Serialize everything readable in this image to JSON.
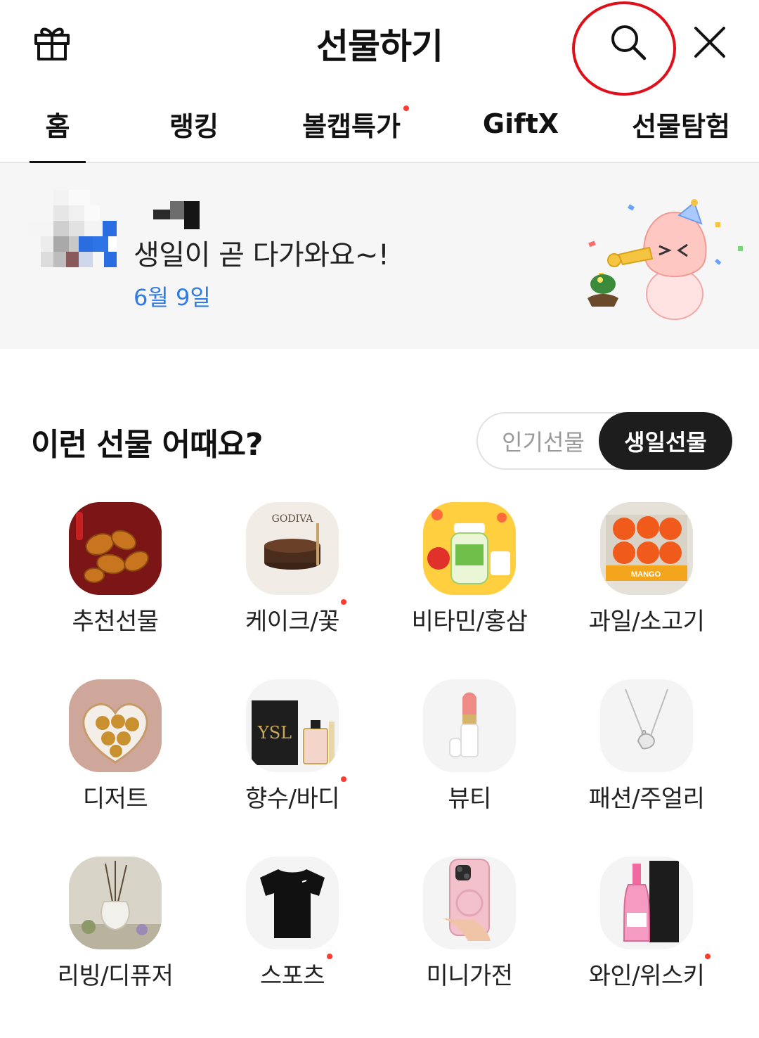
{
  "header": {
    "title": "선물하기",
    "gift_icon": "gift-icon",
    "search_icon": "search-icon",
    "close_icon": "close-icon"
  },
  "tabs": [
    {
      "label": "홈",
      "active": true,
      "new": false
    },
    {
      "label": "랭킹",
      "active": false,
      "new": false
    },
    {
      "label": "볼캡특가",
      "active": false,
      "new": true
    },
    {
      "label": "GiftX",
      "active": false,
      "new": false
    },
    {
      "label": "선물탐험",
      "active": false,
      "new": false
    }
  ],
  "birthday_banner": {
    "message": "생일이 곧 다가와요~!",
    "date": "6월 9일"
  },
  "recommend": {
    "title": "이런 선물 어때요?",
    "toggle": {
      "options": [
        "인기선물",
        "생일선물"
      ],
      "selected": "생일선물"
    }
  },
  "categories": [
    {
      "label": "추천선물",
      "new": false
    },
    {
      "label": "케이크/꽃",
      "new": true
    },
    {
      "label": "비타민/홍삼",
      "new": false
    },
    {
      "label": "과일/소고기",
      "new": false
    },
    {
      "label": "디저트",
      "new": false
    },
    {
      "label": "향수/바디",
      "new": true
    },
    {
      "label": "뷰티",
      "new": false
    },
    {
      "label": "패션/주얼리",
      "new": false
    },
    {
      "label": "리빙/디퓨저",
      "new": false
    },
    {
      "label": "스포츠",
      "new": true
    },
    {
      "label": "미니가전",
      "new": false
    },
    {
      "label": "와인/위스키",
      "new": true
    }
  ],
  "colors": {
    "accent_blue": "#2f7be5",
    "badge_red": "#ff3b30",
    "annotation_red": "#e0101b",
    "toggle_selected_bg": "#1d1d1d"
  }
}
